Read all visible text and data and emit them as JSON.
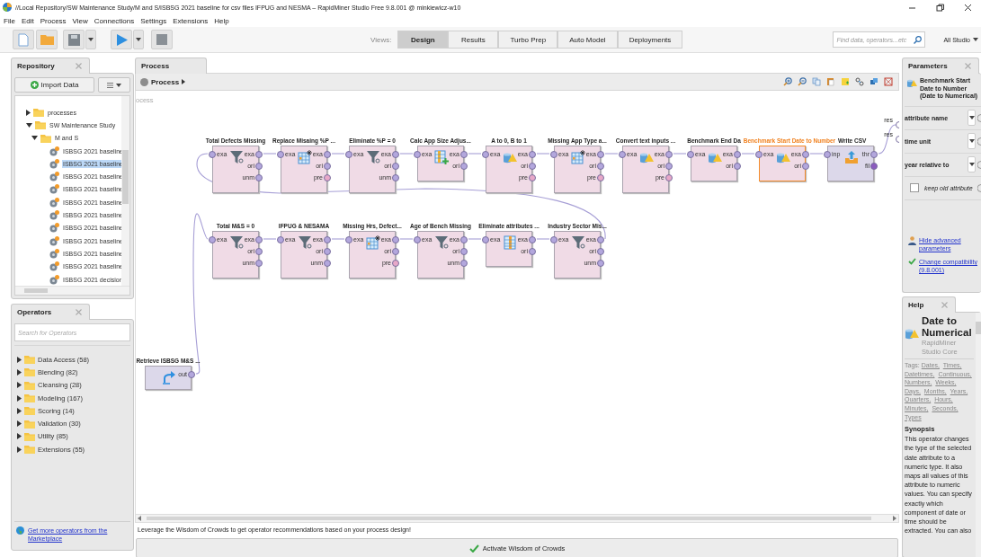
{
  "window": {
    "title": "//Local Repository/SW Maintenance Study/M and S/ISBSG 2021 baseline for csv files IFPUG and NESMA – RapidMiner Studio Free 9.8.001 @ minkiewicz-w10"
  },
  "menu": [
    "File",
    "Edit",
    "Process",
    "View",
    "Connections",
    "Settings",
    "Extensions",
    "Help"
  ],
  "toolbar": {
    "views_label": "Views:",
    "views": [
      {
        "label": "Design",
        "selected": true
      },
      {
        "label": "Results",
        "selected": false
      },
      {
        "label": "Turbo Prep",
        "selected": false
      },
      {
        "label": "Auto Model",
        "selected": false
      },
      {
        "label": "Deployments",
        "selected": false
      }
    ],
    "search": {
      "placeholder": "Find data, operators...etc"
    },
    "scope": "All Studio"
  },
  "repository": {
    "title": "Repository",
    "import_button": "Import Data",
    "tree": [
      {
        "label": "processes",
        "kind": "folder",
        "expanded": false,
        "selected": false
      },
      {
        "label": "SW Maintenance Study",
        "kind": "folder",
        "expanded": true,
        "selected": false,
        "children": [
          {
            "label": "M and S",
            "kind": "folder",
            "expanded": true,
            "selected": false,
            "children": [
              {
                "label": "ISBSG 2021 baseline",
                "kind": "process",
                "selected": false
              },
              {
                "label": "ISBSG 2021 baseline",
                "kind": "process",
                "selected": true
              },
              {
                "label": "ISBSG 2021 baseline",
                "kind": "process",
                "selected": false
              },
              {
                "label": "ISBSG 2021 baseline",
                "kind": "process",
                "selected": false
              },
              {
                "label": "ISBSG 2021 baseline",
                "kind": "process",
                "selected": false
              },
              {
                "label": "ISBSG 2021 baseline",
                "kind": "process",
                "selected": false
              },
              {
                "label": "ISBSG 2021 baseline",
                "kind": "process",
                "selected": false
              },
              {
                "label": "ISBSG 2021 baseline",
                "kind": "process",
                "selected": false
              },
              {
                "label": "ISBSG 2021 baseline",
                "kind": "process",
                "selected": false
              },
              {
                "label": "ISBSG 2021 baseline",
                "kind": "process",
                "selected": false
              },
              {
                "label": "ISBSG 2021 decision",
                "kind": "process",
                "selected": false
              }
            ]
          }
        ]
      }
    ]
  },
  "operators": {
    "title": "Operators",
    "search": {
      "placeholder": "Search for Operators"
    },
    "groups": [
      {
        "label": "Data Access (58)",
        "expanded": false
      },
      {
        "label": "Blending (82)",
        "expanded": false
      },
      {
        "label": "Cleansing (28)",
        "expanded": false
      },
      {
        "label": "Modeling (167)",
        "expanded": false
      },
      {
        "label": "Scoring (14)",
        "expanded": false
      },
      {
        "label": "Validation (30)",
        "expanded": false
      },
      {
        "label": "Utility (85)",
        "expanded": false
      },
      {
        "label": "Extensions (55)",
        "expanded": false
      }
    ],
    "marketplace_link": "Get more operators from the Marketplace"
  },
  "process": {
    "tab": "Process",
    "breadcrumb": "Process",
    "canvas_label": "ocess",
    "rows": [
      {
        "nodes": [
          {
            "title": "Total Defects Missing",
            "kind": "filter",
            "selected": false,
            "inputs": [
              {
                "label": "exa",
                "kind": "example"
              }
            ],
            "outputs": [
              {
                "label": "exa",
                "kind": "example"
              },
              {
                "label": "ori",
                "kind": "example"
              },
              {
                "label": "unm",
                "kind": "example"
              }
            ]
          },
          {
            "title": "Replace Misaing %P ...",
            "kind": "table",
            "selected": false,
            "inputs": [
              {
                "label": "exa",
                "kind": "example"
              }
            ],
            "outputs": [
              {
                "label": "exa",
                "kind": "example"
              },
              {
                "label": "ori",
                "kind": "example"
              },
              {
                "label": "pre",
                "kind": "model"
              }
            ]
          },
          {
            "title": "Eliminate %P = 0",
            "kind": "filter",
            "selected": false,
            "inputs": [
              {
                "label": "exa",
                "kind": "example"
              }
            ],
            "outputs": [
              {
                "label": "exa",
                "kind": "example"
              },
              {
                "label": "ori",
                "kind": "example"
              },
              {
                "label": "unm",
                "kind": "example"
              }
            ]
          },
          {
            "title": "Calc App Size Adjus...",
            "kind": "generate",
            "selected": false,
            "inputs": [
              {
                "label": "exa",
                "kind": "example"
              }
            ],
            "outputs": [
              {
                "label": "exa",
                "kind": "example"
              },
              {
                "label": "ori",
                "kind": "example"
              }
            ]
          },
          {
            "title": "A to 0, B to 1",
            "kind": "convert",
            "selected": false,
            "inputs": [
              {
                "label": "exa",
                "kind": "example"
              }
            ],
            "outputs": [
              {
                "label": "exa",
                "kind": "example"
              },
              {
                "label": "ori",
                "kind": "example"
              },
              {
                "label": "pre",
                "kind": "model"
              }
            ]
          },
          {
            "title": "Missing  App Type a...",
            "kind": "table",
            "selected": false,
            "inputs": [
              {
                "label": "exa",
                "kind": "example"
              }
            ],
            "outputs": [
              {
                "label": "exa",
                "kind": "example"
              },
              {
                "label": "ori",
                "kind": "example"
              },
              {
                "label": "pre",
                "kind": "model"
              }
            ]
          },
          {
            "title": "Convert text inputs ...",
            "kind": "convert",
            "selected": false,
            "inputs": [
              {
                "label": "exa",
                "kind": "example"
              }
            ],
            "outputs": [
              {
                "label": "exa",
                "kind": "example"
              },
              {
                "label": "ori",
                "kind": "example"
              },
              {
                "label": "pre",
                "kind": "model"
              }
            ]
          },
          {
            "title": "Benchmark End Da",
            "kind": "convert",
            "selected": false,
            "inputs": [
              {
                "label": "exa",
                "kind": "example"
              }
            ],
            "outputs": [
              {
                "label": "exa",
                "kind": "example"
              },
              {
                "label": "ori",
                "kind": "example"
              }
            ]
          },
          {
            "title": "Benchmark Start Date to Number",
            "kind": "convert",
            "selected": true,
            "inputs": [
              {
                "label": "exa",
                "kind": "example"
              }
            ],
            "outputs": [
              {
                "label": "exa",
                "kind": "example"
              },
              {
                "label": "ori",
                "kind": "example"
              }
            ]
          },
          {
            "title": "Write CSV",
            "kind": "export",
            "selected": false,
            "inputs": [
              {
                "label": "inp",
                "kind": "example"
              }
            ],
            "outputs": [
              {
                "label": "thr",
                "kind": "example"
              },
              {
                "label": "fil",
                "kind": "file"
              }
            ]
          }
        ]
      },
      {
        "nodes": [
          {
            "title": "Total M&S = 0",
            "kind": "filter",
            "selected": false,
            "inputs": [
              {
                "label": "exa",
                "kind": "example"
              }
            ],
            "outputs": [
              {
                "label": "exa",
                "kind": "example"
              },
              {
                "label": "ori",
                "kind": "example"
              },
              {
                "label": "unm",
                "kind": "example"
              }
            ]
          },
          {
            "title": "IFPUG & NESAMA",
            "kind": "filter",
            "selected": false,
            "inputs": [
              {
                "label": "exa",
                "kind": "example"
              }
            ],
            "outputs": [
              {
                "label": "exa",
                "kind": "example"
              },
              {
                "label": "ori",
                "kind": "example"
              },
              {
                "label": "unm",
                "kind": "example"
              }
            ]
          },
          {
            "title": "Missing Hrs, Defect...",
            "kind": "table",
            "selected": false,
            "inputs": [
              {
                "label": "exa",
                "kind": "example"
              }
            ],
            "outputs": [
              {
                "label": "exa",
                "kind": "example"
              },
              {
                "label": "ori",
                "kind": "example"
              },
              {
                "label": "pre",
                "kind": "model"
              }
            ]
          },
          {
            "title": "Age of Bench Missing",
            "kind": "filter",
            "selected": false,
            "inputs": [
              {
                "label": "exa",
                "kind": "example"
              }
            ],
            "outputs": [
              {
                "label": "exa",
                "kind": "example"
              },
              {
                "label": "ori",
                "kind": "example"
              },
              {
                "label": "unm",
                "kind": "example"
              }
            ]
          },
          {
            "title": "Eliminate attributes ...",
            "kind": "select",
            "selected": false,
            "inputs": [
              {
                "label": "exa",
                "kind": "example"
              }
            ],
            "outputs": [
              {
                "label": "exa",
                "kind": "example"
              },
              {
                "label": "ori",
                "kind": "example"
              }
            ]
          },
          {
            "title": "Industry Sector Mis...",
            "kind": "filter",
            "selected": false,
            "inputs": [
              {
                "label": "exa",
                "kind": "example"
              }
            ],
            "outputs": [
              {
                "label": "exa",
                "kind": "example"
              },
              {
                "label": "ori",
                "kind": "example"
              },
              {
                "label": "unm",
                "kind": "example"
              }
            ]
          }
        ]
      }
    ],
    "source": {
      "title": "Retrieve ISBSG M&S ...",
      "kind": "retrieve",
      "selected": false,
      "outputs": [
        {
          "label": "out",
          "kind": "example"
        }
      ]
    },
    "result_ports": [
      {
        "label": "res"
      },
      {
        "label": "res"
      }
    ]
  },
  "wisdom": {
    "text": "Leverage the Wisdom of Crowds to get operator recommendations based on your process design!",
    "button": "Activate Wisdom of Crowds"
  },
  "parameters": {
    "title": "Parameters",
    "operator": "Benchmark Start Date to Number (Date to Numerical)",
    "params": [
      {
        "kind": "dropdown",
        "label": "attribute name"
      },
      {
        "kind": "dropdown",
        "label": "time unit"
      },
      {
        "kind": "dropdown",
        "label": "year relative to"
      },
      {
        "kind": "checkbox",
        "label": "keep old attribute",
        "checked": false
      }
    ],
    "links": [
      {
        "kind": "advanced",
        "label": "Hide advanced parameters"
      },
      {
        "kind": "compatibility",
        "label": "Change compatibility (9.8.001)"
      }
    ]
  },
  "help": {
    "title": "Help",
    "operator": "Date to Numerical",
    "source": "RapidMiner Studio Core",
    "tags_label": "Tags:",
    "tags": [
      "Dates,",
      "Times,",
      "Datetimes,",
      "Continuous,",
      "Numbers,",
      "Weeks,",
      "Days,",
      "Months,",
      "Years,",
      "Quarters,",
      "Hours,",
      "Minutes,",
      "Seconds,",
      "Types"
    ],
    "heading": "Synopsis",
    "synopsis": "This operator changes the type of the selected date attribute to a numeric type. It also maps all values of this attribute to numeric values. You can specify exactly which component of date or time should be extracted. You can also"
  }
}
